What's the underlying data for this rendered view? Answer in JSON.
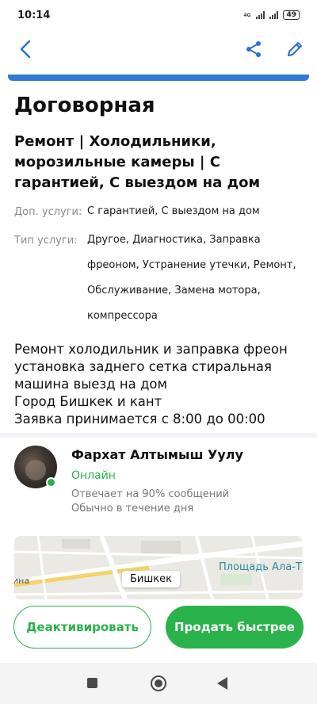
{
  "status_bar": {
    "time": "10:14",
    "network_label": "4G",
    "battery": "49"
  },
  "toolbar": {
    "back_icon": "chevron-left-icon",
    "share_icon": "share-icon",
    "edit_icon": "pencil-icon"
  },
  "colors": {
    "accent_blue": "#2f7bd6",
    "green": "#2ab24b"
  },
  "listing": {
    "price": "Договорная",
    "title": "Ремонт | Холодильники, морозильные камеры | С гарантией, С выездом на дом",
    "props": [
      {
        "label": "Доп. услуги:",
        "value": "С гарантией, С выездом на дом"
      },
      {
        "label": "Тип услуги:",
        "value": "Другое, Диагностика, Заправка фреоном, Устранение утечки, Ремонт, Обслуживание, Замена мотора, компрессора"
      }
    ],
    "description": "Ремонт холодильник и заправка фреон\nустановка заднего сетка стиральная\nмашина выезд на дом\nГород Бишкек и кант\nЗаявка принимается с 8:00 до 00:00"
  },
  "seller": {
    "name": "Фархат Алтымыш Уулу",
    "status": "Онлайн",
    "reply_rate": "Отвечает на 90% сообщений",
    "reply_time": "Обычно в течение дня"
  },
  "map": {
    "city": "Бишкек",
    "square": "Площадь Ала-Т",
    "edge_text": "ина"
  },
  "actions": {
    "deactivate": "Деактивировать",
    "sell_faster": "Продать быстрее"
  }
}
